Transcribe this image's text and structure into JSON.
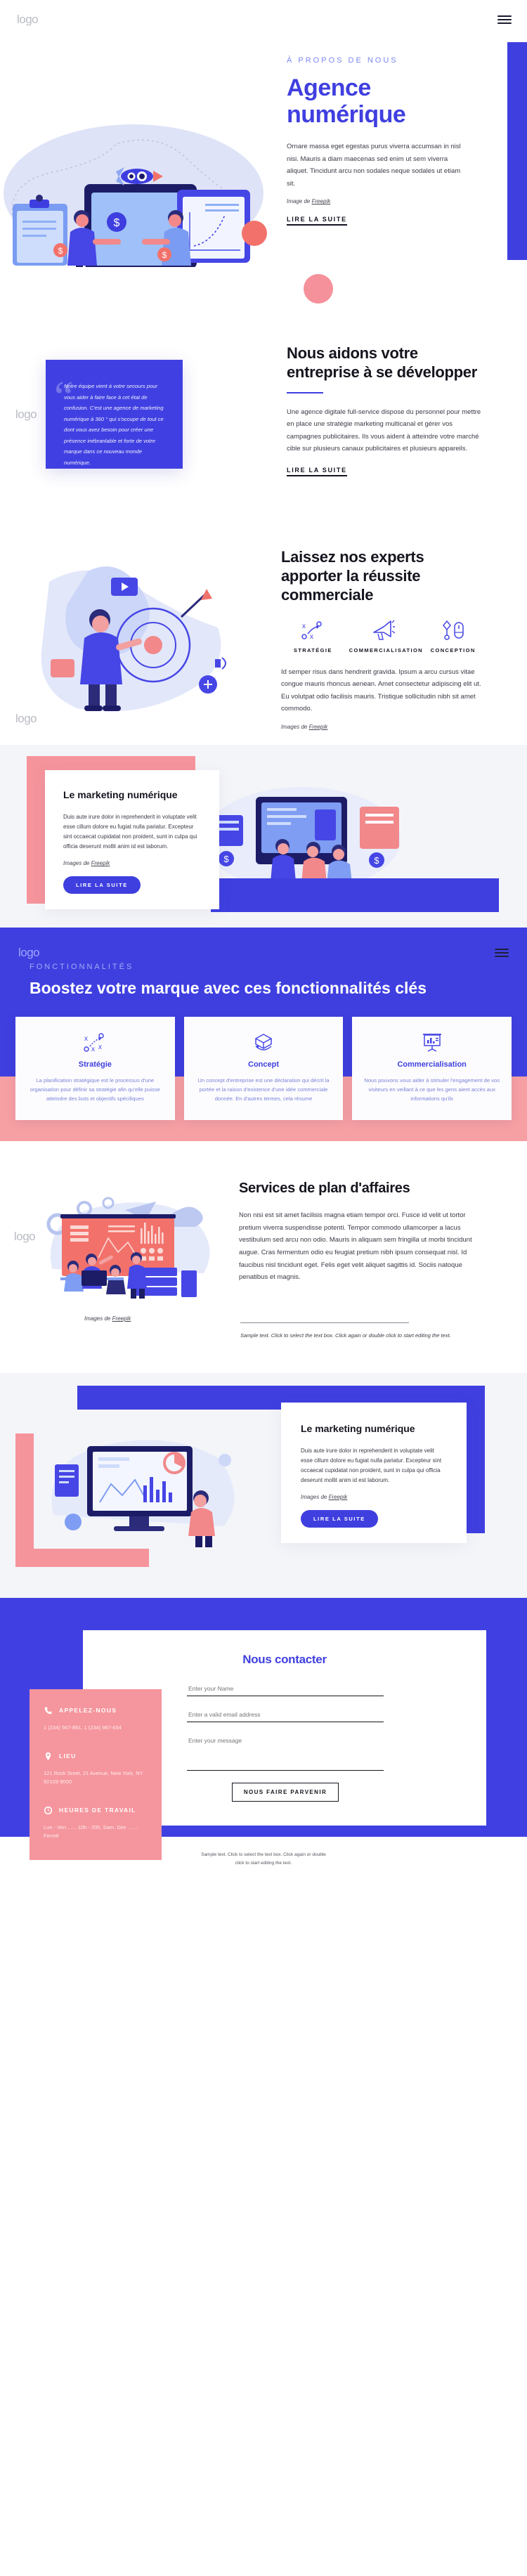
{
  "brand": {
    "logo": "logo",
    "accent": "#3f3fe0",
    "pink": "#f5959d",
    "dark": "#15151f"
  },
  "menu": {
    "icon": "hamburger-menu-icon"
  },
  "hero": {
    "eyebrow": "À PROPOS DE NOUS",
    "title": "Agence numérique",
    "body": "Ornare massa eget egestas purus viverra accumsan in nisl nisi. Mauris a diam maecenas sed enim ut sem viverra aliquet. Tincidunt arcu non sodales neque sodales ut etiam sit.",
    "credit_prefix": "Image de ",
    "credit_link": "Freepik",
    "cta": "LIRE LA SUITE"
  },
  "quote": {
    "text": "Notre équipe vient à votre secours pour vous aider à faire face à cet état de confusion. C'est une agence de marketing numérique à 360 ° qui s'occupe de tout ce dont vous avez besoin pour créer une présence inébranlable et forte de votre marque dans ce nouveau monde numérique.",
    "title": "Nous aidons votre entreprise à se développer",
    "body": "Une agence digitale full-service dispose du personnel pour mettre en place une stratégie marketing multicanal et gérer vos campagnes publicitaires. Ils vous aident à atteindre votre marché cible sur plusieurs canaux publicitaires et plusieurs appareils.",
    "cta": "LIRE LA SUITE"
  },
  "experts": {
    "title": "Laissez nos experts apporter la réussite commerciale",
    "items": [
      {
        "icon": "strategy-icon",
        "label": "STRATÉGIE"
      },
      {
        "icon": "megaphone-icon",
        "label": "COMMERCIALISATION"
      },
      {
        "icon": "design-mouse-icon",
        "label": "CONCEPTION"
      }
    ],
    "body": "Id semper risus dans hendrerit gravida. Ipsum a arcu cursus vitae congue mauris rhoncus aenean. Amet consectetur adipiscing elit ut. Eu volutpat odio facilisis mauris. Tristique sollicitudin nibh sit amet commodo.",
    "credit_prefix": "Images de ",
    "credit_link": "Freepik"
  },
  "marketing1": {
    "title": "Le marketing numérique",
    "body": "Duis aute irure dolor in reprehenderit in voluptate velit esse cillum dolore eu fugiat nulla pariatur. Excepteur sint occaecat cupidatat non proident, sunt in culpa qui officia deserunt mollit anim id est laborum.",
    "credit_prefix": "Images de ",
    "credit_link": "Freepik",
    "cta": "LIRE LA SUITE"
  },
  "features": {
    "eyebrow": "FONCTIONNALITÉS",
    "title": "Boostez votre marque avec ces fonctionnalités clés",
    "cards": [
      {
        "icon": "strategy-icon",
        "title": "Stratégie",
        "body": "La planification stratégique est le processus d'une organisation pour définir sa stratégie afin qu'elle puisse atteindre des buts et objectifs spécifiques"
      },
      {
        "icon": "cube-rotate-icon",
        "title": "Concept",
        "body": "Un concept d'entreprise est une déclaration qui décrit la portée et la raison d'existence d'une idée commerciale donnée. En d'autres termes, cela résume"
      },
      {
        "icon": "presentation-chart-icon",
        "title": "Commercialisation",
        "body": "Nous pouvons vous aider à stimuler l'engagement de vos visiteurs en veillant à ce que les gens aient accès aux informations qu'ils"
      }
    ]
  },
  "services": {
    "title": "Services de plan d'affaires",
    "body": "Non nisi est sit amet facilisis magna etiam tempor orci. Fusce id velit ut tortor pretium viverra suspendisse potenti. Tempor commodo ullamcorper a lacus vestibulum sed arcu non odio. Mauris in aliquam sem fringilla ut morbi tincidunt augue. Cras fermentum odio eu feugiat pretium nibh ipsum consequat nisl. Id faucibus nisl tincidunt eget. Felis eget velit aliquet sagittis id. Sociis natoque penatibus et magnis.",
    "credit_prefix": "Images de ",
    "credit_link": "Freepik",
    "sample": "Sample text. Click to select the text box. Click again or double click to start editing the text."
  },
  "marketing2": {
    "title": "Le marketing numérique",
    "body": "Duis aute irure dolor in reprehenderit in voluptate velit esse cillum dolore eu fugiat nulla pariatur. Excepteur sint occaecat cupidatat non proident, sunt in culpa qui officia deserunt mollit anim id est laborum.",
    "credit_prefix": "Images de ",
    "credit_link": "Freepik",
    "cta": "LIRE LA SUITE"
  },
  "contact": {
    "title": "Nous contacter",
    "name_placeholder": "Enter your Name",
    "email_placeholder": "Enter a valid email address",
    "message_placeholder": "Enter your message",
    "submit": "NOUS FAIRE PARVENIR",
    "info": [
      {
        "icon": "phone-icon",
        "title": "APPELEZ-NOUS",
        "value": "1 (234) 567-891, 1 (234) 987-654"
      },
      {
        "icon": "location-pin-icon",
        "title": "LIEU",
        "value": "121 Rock Sreet, 21 Avenue, New York, NY 92103-9000"
      },
      {
        "icon": "clock-icon",
        "title": "HEURES DE TRAVAIL",
        "value": "Lun - Ven ...... 10h - 20h, Sam, Dim ....... Fermé"
      }
    ]
  },
  "footer": {
    "line1": "Sample text. Click to select the text box. Click again or double",
    "line2": "click to start editing the text."
  }
}
